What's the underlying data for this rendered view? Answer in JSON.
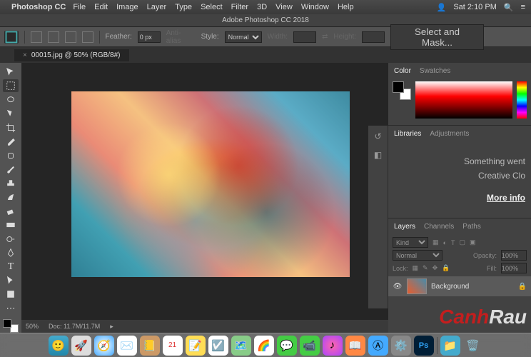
{
  "menubar": {
    "app": "Photoshop CC",
    "items": [
      "File",
      "Edit",
      "Image",
      "Layer",
      "Type",
      "Select",
      "Filter",
      "3D",
      "View",
      "Window",
      "Help"
    ],
    "time": "Sat 2:10 PM"
  },
  "titlebar": "Adobe Photoshop CC 2018",
  "options": {
    "feather_label": "Feather:",
    "feather_value": "0 px",
    "antialias": "Anti-alias",
    "style_label": "Style:",
    "style_value": "Normal",
    "width_label": "Width:",
    "height_label": "Height:",
    "select_mask": "Select and Mask..."
  },
  "doc_tab": {
    "title": "00015.jpg @ 50% (RGB/8#)",
    "close": "×"
  },
  "status": {
    "zoom": "50%",
    "doc": "Doc: 11.7M/11.7M"
  },
  "panels": {
    "color_tabs": [
      "Color",
      "Swatches"
    ],
    "lib_tabs": [
      "Libraries",
      "Adjustments"
    ],
    "lib_msg1": "Something went",
    "lib_msg2": "Creative Clo",
    "lib_more": "More info",
    "layers_tabs": [
      "Layers",
      "Channels",
      "Paths"
    ],
    "kind_label": "Kind",
    "blend": "Normal",
    "opacity_label": "Opacity:",
    "opacity_value": "100%",
    "lock_label": "Lock:",
    "fill_label": "Fill:",
    "fill_value": "100%",
    "layer_name": "Background"
  },
  "watermark": {
    "p1": "Canh",
    "p2": "Rau"
  }
}
